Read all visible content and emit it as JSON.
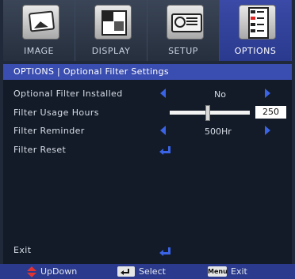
{
  "tabs": [
    {
      "label": "IMAGE",
      "icon": "image-icon",
      "active": false
    },
    {
      "label": "DISPLAY",
      "icon": "display-icon",
      "active": false
    },
    {
      "label": "SETUP",
      "icon": "setup-icon",
      "active": false
    },
    {
      "label": "OPTIONS",
      "icon": "options-icon",
      "active": true
    }
  ],
  "title": "OPTIONS | Optional Filter Settings",
  "rows": {
    "installed": {
      "label": "Optional Filter Installed",
      "value": "No"
    },
    "usage": {
      "label": "Filter Usage Hours",
      "value": "250",
      "slider_level": 0.48
    },
    "reminder": {
      "label": "Filter Reminder",
      "value": "500Hr"
    },
    "reset": {
      "label": "Filter Reset"
    },
    "exit": {
      "label": "Exit"
    }
  },
  "footer": {
    "updown": "UpDown",
    "select": "Select",
    "menu_key": "Menu",
    "exit": "Exit"
  },
  "colors": {
    "accent": "#3a63e6",
    "title_bar": "#3a4db0",
    "active_tab": "#3a4aa6",
    "footer": "#2b3a8c",
    "panel": "#131b28",
    "alert": "#e23333"
  }
}
